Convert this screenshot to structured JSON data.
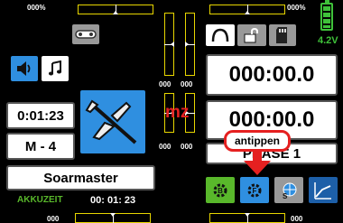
{
  "top_left_trim_label": "000%",
  "top_right_trim_label": "000%",
  "battery": {
    "voltage": "4.2V",
    "color": "#3fc23a"
  },
  "timers": {
    "top": "000:00.0",
    "bottom": "000:00.0"
  },
  "left_time": "0:01:23",
  "model_slot": "M - 4",
  "model_name": "Soarmaster",
  "akku": {
    "label": "AKKUZEIT",
    "value": "00: 01: 23"
  },
  "mz_label": "mz",
  "trim_values": {
    "left_v_top": "000",
    "left_v_top2": "000",
    "left_v_bot": "000",
    "left_v_bot2": "000",
    "bottom_left": "000",
    "bottom_right": "000"
  },
  "phase": {
    "text": "PHASE 1",
    "visible_text": "P   ASE 1"
  },
  "callout": {
    "text": "antippen"
  },
  "icons": {
    "speaker": "speaker-icon",
    "music": "music-note-icon",
    "servo_link": "servo-link-icon",
    "arc": "arc-icon",
    "lock": "unlock-icon",
    "sdcard": "sd-card-icon",
    "plane": "airplane-icon"
  },
  "colors": {
    "accent_blue": "#2f8fe0",
    "accent_green": "#59b82b",
    "trim_yellow": "#e8d600",
    "red": "#e52020"
  }
}
